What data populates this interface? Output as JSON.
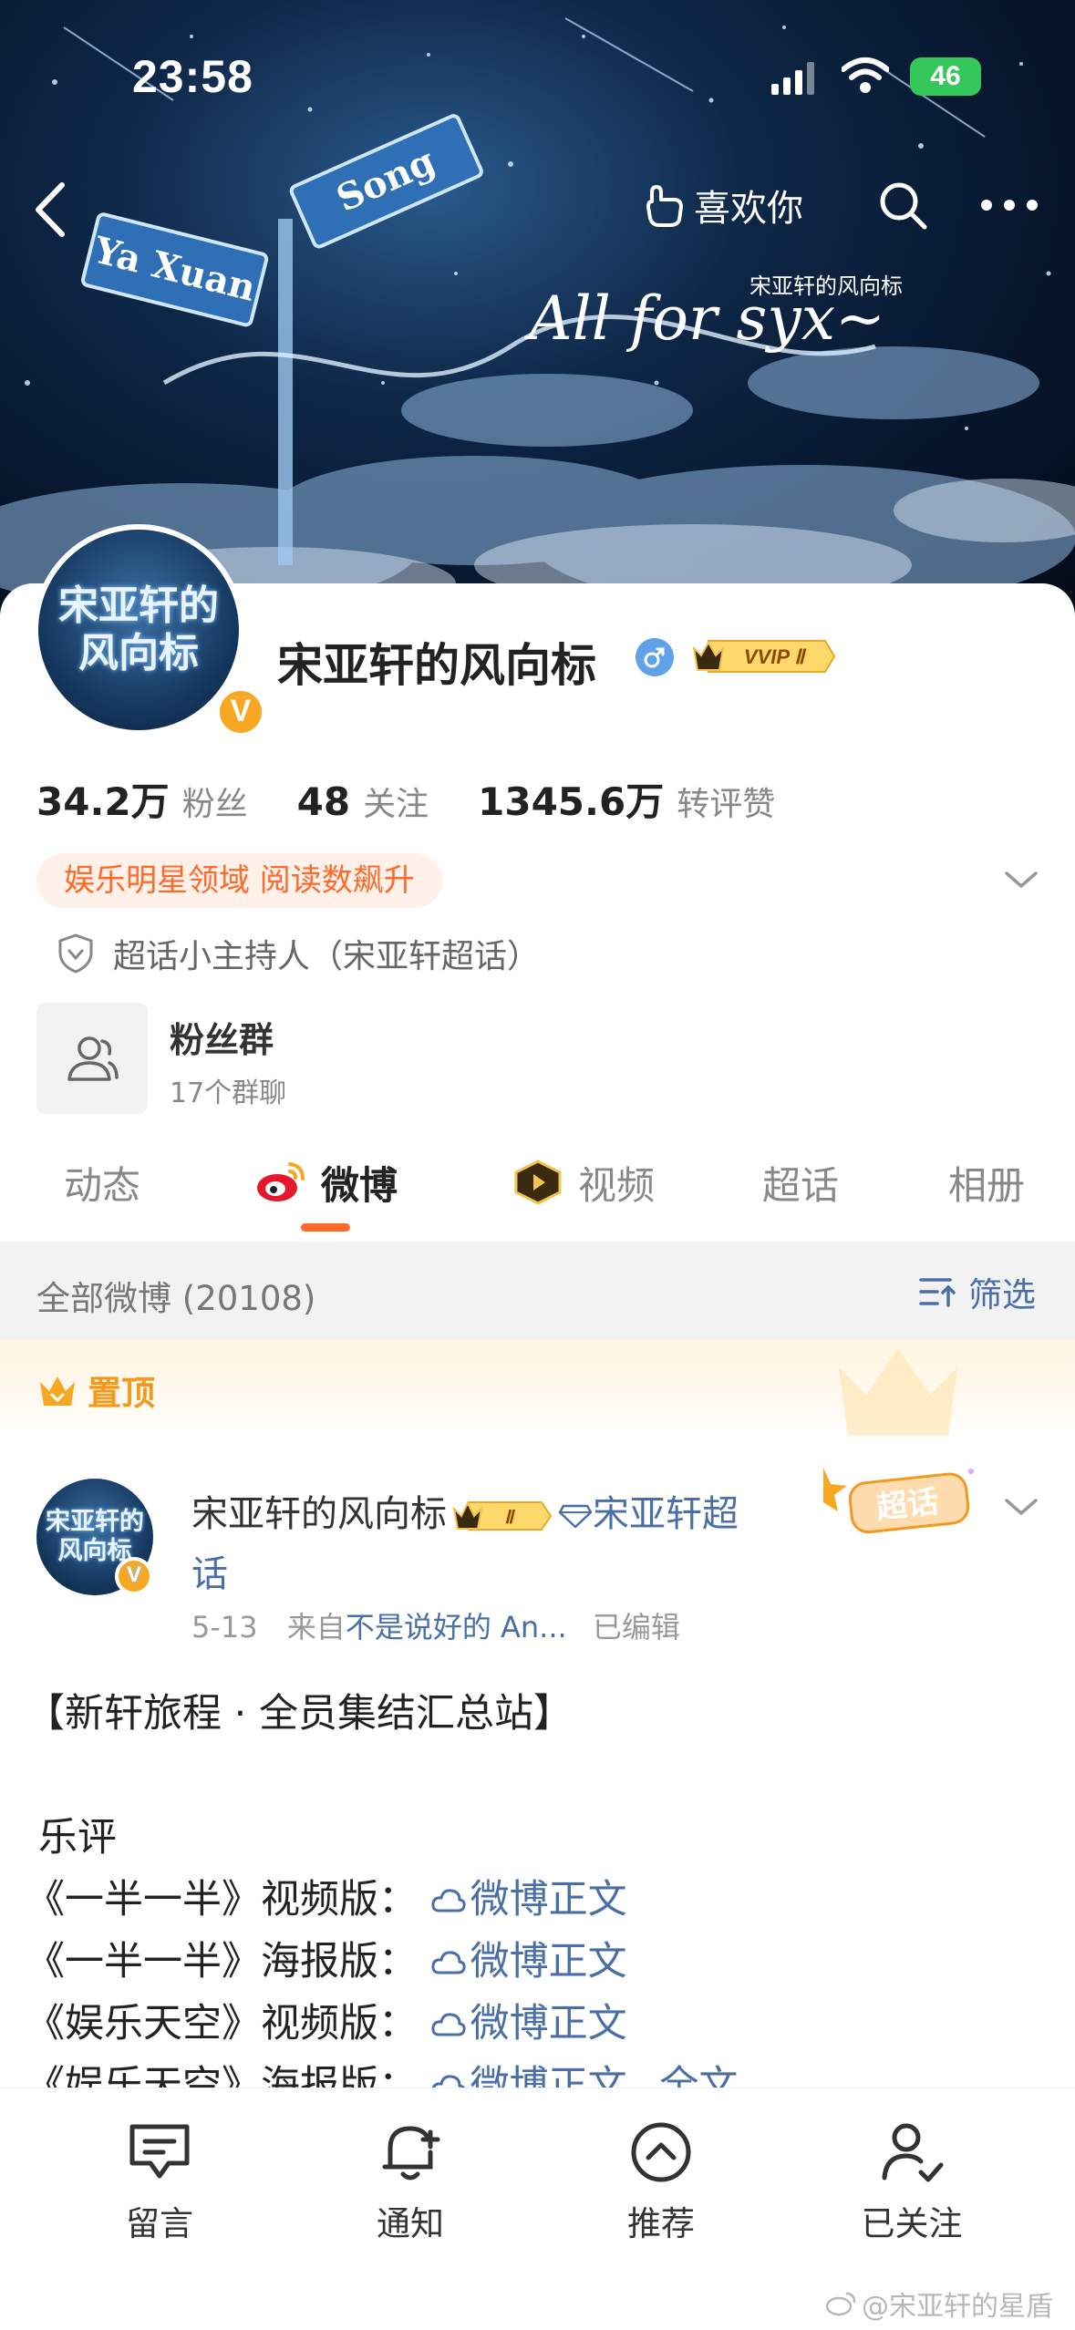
{
  "status_bar": {
    "time": "23:58",
    "network": "46"
  },
  "header": {
    "like_label": "喜欢你"
  },
  "banner": {
    "sign_left": "Ya Xuan",
    "sign_right": "Song",
    "title_cn": "宋亚轩的风向标",
    "title_script": "All for syx~"
  },
  "profile": {
    "avatar_line1": "宋亚轩的",
    "avatar_line2": "风向标",
    "verified_mark": "V",
    "name": "宋亚轩的风向标",
    "vip_badge": "VVIP Ⅱ",
    "stats": [
      {
        "num": "34.2万",
        "label": "粉丝"
      },
      {
        "num": "48",
        "label": "关注"
      },
      {
        "num": "1345.6万",
        "label": "转评赞"
      }
    ],
    "tag": "娱乐明星领域 阅读数飙升",
    "supertalk_role": "超话小主持人（宋亚轩超话）",
    "fan_group": {
      "title": "粉丝群",
      "subtitle": "17个群聊"
    }
  },
  "tabs": [
    {
      "label": "动态",
      "active": false
    },
    {
      "label": "微博",
      "active": true
    },
    {
      "label": "视频",
      "active": false
    },
    {
      "label": "超话",
      "active": false
    },
    {
      "label": "相册",
      "active": false
    }
  ],
  "feed": {
    "count_label": "全部微博 (20108)",
    "filter_label": "筛选",
    "pinned_label": "置顶"
  },
  "post": {
    "avatar_line1": "宋亚轩的",
    "avatar_line2": "风向标",
    "author": "宋亚轩的风向标",
    "crown_level": "Ⅱ",
    "topic": "宋亚轩超话",
    "sticker": "超话",
    "date": "5-13",
    "source_prefix": "来自",
    "source": "不是说好的 An...",
    "edited": "已编辑",
    "title": "【新轩旅程 · 全员集结汇总站】",
    "section": "乐评",
    "items": [
      {
        "label": "《一半一半》视频版：",
        "link": "微博正文"
      },
      {
        "label": "《一半一半》海报版：",
        "link": "微博正文"
      },
      {
        "label": "《娱乐天空》视频版：",
        "link": "微博正文"
      },
      {
        "label": "《娱乐天空》海报版：",
        "link": "微博正文",
        "more": "全文"
      }
    ]
  },
  "bottom_bar": [
    {
      "label": "留言",
      "icon": "comment-icon"
    },
    {
      "label": "通知",
      "icon": "bell-plus-icon"
    },
    {
      "label": "推荐",
      "icon": "chevron-up-circle-icon"
    },
    {
      "label": "已关注",
      "icon": "user-check-icon"
    }
  ],
  "watermark": "@宋亚轩的星盾",
  "colors": {
    "accent": "#ff6a2b",
    "link": "#4a6fa8",
    "gold": "#f7a823",
    "battery": "#34c759"
  }
}
